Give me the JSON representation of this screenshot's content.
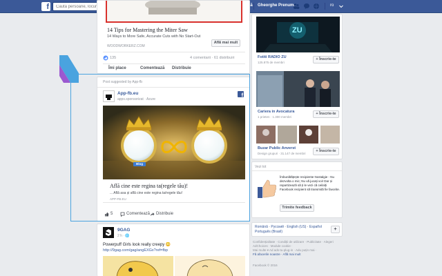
{
  "topbar": {
    "search_placeholder": "Caută persoane, locuri și lucruri",
    "home_label": "Acasă",
    "user_label": "Gheorghe Prenume",
    "lang_label": "ro"
  },
  "post1": {
    "title": "14 Tips for Mastering the Miter Saw",
    "desc": "14 Ways to More Safe, Accurate Cuts with No Start-Out",
    "domain": "WOODWORKERZ.COM",
    "more_button": "Află mai mult",
    "reactions": "135",
    "stats": "4 comentarii · 61 distribuiri",
    "like": "Îmi place",
    "comment": "Comentează",
    "share": "Distribuie"
  },
  "post2": {
    "suggested": "Post suggested by App-fb",
    "page_name": "App-fb.eu",
    "page_sub": "apps.sponsorizat · Azure",
    "link_title": "Află cine este regina ta(regele tău)!",
    "link_desc": "... Află asa și află cine este regina ta/regele tău!",
    "link_domain": "APP-FB.EU",
    "likes": "5",
    "comment": "Comentează",
    "share": "Distribuie",
    "badge": "Blog"
  },
  "post3": {
    "page_name": "9GAG",
    "time": "2 h · 🌐",
    "text": "Powerpuff Girls look really creepy 😳",
    "link": "http://9gag.com/gag/angEXGx?ref=fbp"
  },
  "sidebar": {
    "ad1": {
      "title": "Fotiti RADIO ZU",
      "sub": "125.875 de membri",
      "button": "Înscrie-te",
      "image_text": "ZU"
    },
    "ad2": {
      "title": "Cariera in Avocatura",
      "sub": "1 prieten · 1.300 membri",
      "button": "Înscrie-te"
    },
    "ad3": {
      "title": "Buzar Public Anverst",
      "sub": "Design grupuri · 31.147 de membri",
      "button": "Înscrie-te"
    },
    "promo_header": "Vezi tot",
    "promo_text": "Îmbunătățește recipiente Nostalgie - Nu dezvolta o mic; Nu vă jucați voi! Dar și repartizează să ți le vezi că ceilalți Facebook recipient să transmită fie favorite.",
    "promo_button": "Trimite feedback"
  },
  "languages": {
    "items": [
      "Română",
      "Русский",
      "English (US)",
      "Español",
      "Português (Brasil)"
    ],
    "plus": "+"
  },
  "footer": {
    "lines": [
      "Confidențialitate · Condiții de utilizare · Publicitate · Alegeri AdChoices · Module cookie ·",
      "Mai multe ▾ Ad ads-tu-plug-in · Adu puțin mai ·"
    ],
    "links": "Fă afacerile noastre · Află mai mult",
    "copyright": "Facebook © 2016"
  }
}
